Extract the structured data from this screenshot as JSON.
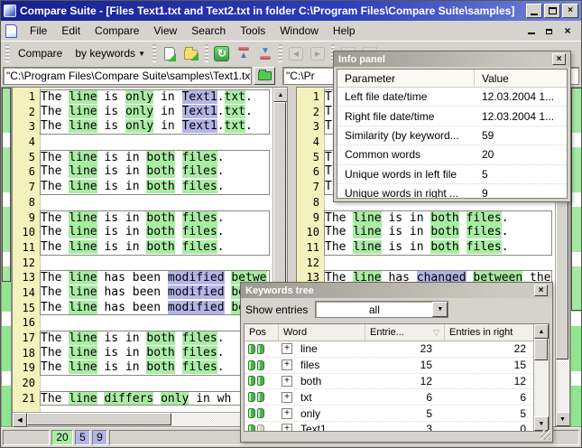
{
  "window": {
    "title": "Compare Suite - [Files Text1.txt and Text2.txt in folder C:\\Program Files\\Compare Suite\\samples]"
  },
  "menu": {
    "items": [
      "File",
      "Edit",
      "Compare",
      "View",
      "Search",
      "Tools",
      "Window",
      "Help"
    ]
  },
  "toolbar": {
    "compare_label": "Compare",
    "mode_label": "by keywords"
  },
  "paths": {
    "left": "\"C:\\Program Files\\Compare Suite\\samples\\Text1.txt\"",
    "right": "\"C:\\Pr"
  },
  "colors": {
    "highlight_common": "#a9eda4",
    "highlight_unique": "#b4b4e9",
    "map_green": "#8ee68e"
  },
  "left_pane": {
    "lines": [
      {
        "n": "1",
        "box": "start",
        "seg": [
          [
            "The ",
            ""
          ],
          [
            "line",
            "g"
          ],
          [
            " is ",
            ""
          ],
          [
            "only",
            "g"
          ],
          [
            " in ",
            ""
          ],
          [
            "Text1",
            "b"
          ],
          [
            ".",
            ""
          ],
          [
            "txt",
            "g"
          ],
          [
            ".",
            ""
          ]
        ]
      },
      {
        "n": "2",
        "box": "mid",
        "seg": [
          [
            "The ",
            ""
          ],
          [
            "line",
            "g"
          ],
          [
            " is ",
            ""
          ],
          [
            "only",
            "g"
          ],
          [
            " in ",
            ""
          ],
          [
            "Text1",
            "b"
          ],
          [
            ".",
            ""
          ],
          [
            "txt",
            "g"
          ],
          [
            ".",
            ""
          ]
        ]
      },
      {
        "n": "3",
        "box": "end",
        "seg": [
          [
            "The ",
            ""
          ],
          [
            "line",
            "g"
          ],
          [
            " is ",
            ""
          ],
          [
            "only",
            "g"
          ],
          [
            " in ",
            ""
          ],
          [
            "Text1",
            "b"
          ],
          [
            ".",
            ""
          ],
          [
            "txt",
            "g"
          ],
          [
            ".",
            ""
          ]
        ]
      },
      {
        "n": "4",
        "box": "none",
        "seg": []
      },
      {
        "n": "5",
        "box": "start",
        "seg": [
          [
            "The ",
            ""
          ],
          [
            "line",
            "g"
          ],
          [
            " is in ",
            ""
          ],
          [
            "both",
            "g"
          ],
          [
            " ",
            ""
          ],
          [
            "files",
            "g"
          ],
          [
            ".",
            ""
          ]
        ]
      },
      {
        "n": "6",
        "box": "mid",
        "seg": [
          [
            "The ",
            ""
          ],
          [
            "line",
            "g"
          ],
          [
            " is in ",
            ""
          ],
          [
            "both",
            "g"
          ],
          [
            " ",
            ""
          ],
          [
            "files",
            "g"
          ],
          [
            ".",
            ""
          ]
        ]
      },
      {
        "n": "7",
        "box": "end",
        "seg": [
          [
            "The ",
            ""
          ],
          [
            "line",
            "g"
          ],
          [
            " is in ",
            ""
          ],
          [
            "both",
            "g"
          ],
          [
            " ",
            ""
          ],
          [
            "files",
            "g"
          ],
          [
            ".",
            ""
          ]
        ]
      },
      {
        "n": "8",
        "box": "none",
        "seg": []
      },
      {
        "n": "9",
        "box": "start",
        "seg": [
          [
            "The ",
            ""
          ],
          [
            "line",
            "g"
          ],
          [
            " is in ",
            ""
          ],
          [
            "both",
            "g"
          ],
          [
            " ",
            ""
          ],
          [
            "files",
            "g"
          ],
          [
            ".",
            ""
          ]
        ]
      },
      {
        "n": "10",
        "box": "mid",
        "seg": [
          [
            "The ",
            ""
          ],
          [
            "line",
            "g"
          ],
          [
            " is in ",
            ""
          ],
          [
            "both",
            "g"
          ],
          [
            " ",
            ""
          ],
          [
            "files",
            "g"
          ],
          [
            ".",
            ""
          ]
        ]
      },
      {
        "n": "11",
        "box": "end",
        "seg": [
          [
            "The ",
            ""
          ],
          [
            "line",
            "g"
          ],
          [
            " is in ",
            ""
          ],
          [
            "both",
            "g"
          ],
          [
            " ",
            ""
          ],
          [
            "files",
            "g"
          ],
          [
            ".",
            ""
          ]
        ]
      },
      {
        "n": "12",
        "box": "none",
        "seg": []
      },
      {
        "n": "13",
        "box": "start",
        "seg": [
          [
            "The ",
            ""
          ],
          [
            "line",
            "g"
          ],
          [
            " has been ",
            ""
          ],
          [
            "modified",
            "b"
          ],
          [
            " ",
            ""
          ],
          [
            "betwe",
            "g"
          ]
        ]
      },
      {
        "n": "14",
        "box": "mid",
        "seg": [
          [
            "The ",
            ""
          ],
          [
            "line",
            "g"
          ],
          [
            " has been ",
            ""
          ],
          [
            "modified",
            "b"
          ],
          [
            " ",
            ""
          ],
          [
            "betwe",
            "g"
          ]
        ]
      },
      {
        "n": "15",
        "box": "end",
        "seg": [
          [
            "The ",
            ""
          ],
          [
            "line",
            "g"
          ],
          [
            " has been ",
            ""
          ],
          [
            "modified",
            "b"
          ],
          [
            " ",
            ""
          ],
          [
            "betwe",
            "g"
          ]
        ]
      },
      {
        "n": "16",
        "box": "none",
        "seg": []
      },
      {
        "n": "17",
        "box": "start",
        "seg": [
          [
            "The ",
            ""
          ],
          [
            "line",
            "g"
          ],
          [
            " is in ",
            ""
          ],
          [
            "both",
            "g"
          ],
          [
            " ",
            ""
          ],
          [
            "files",
            "g"
          ],
          [
            ".",
            ""
          ]
        ]
      },
      {
        "n": "18",
        "box": "mid",
        "seg": [
          [
            "The ",
            ""
          ],
          [
            "line",
            "g"
          ],
          [
            " is in ",
            ""
          ],
          [
            "both",
            "g"
          ],
          [
            " ",
            ""
          ],
          [
            "files",
            "g"
          ],
          [
            ".",
            ""
          ]
        ]
      },
      {
        "n": "19",
        "box": "end",
        "seg": [
          [
            "The ",
            ""
          ],
          [
            "line",
            "g"
          ],
          [
            " is in ",
            ""
          ],
          [
            "both",
            "g"
          ],
          [
            " ",
            ""
          ],
          [
            "files",
            "g"
          ],
          [
            ".",
            ""
          ]
        ]
      },
      {
        "n": "20",
        "box": "none",
        "seg": []
      },
      {
        "n": "21",
        "box": "single",
        "seg": [
          [
            "The ",
            ""
          ],
          [
            "line",
            "g"
          ],
          [
            " ",
            ""
          ],
          [
            "differs",
            "g"
          ],
          [
            " ",
            ""
          ],
          [
            "only",
            "g"
          ],
          [
            " in wh",
            ""
          ]
        ]
      }
    ]
  },
  "right_pane": {
    "lines": [
      {
        "n": "1",
        "box": "start",
        "seg": [
          [
            "T",
            ""
          ]
        ]
      },
      {
        "n": "2",
        "box": "mid",
        "seg": [
          [
            "T",
            ""
          ]
        ]
      },
      {
        "n": "3",
        "box": "end",
        "seg": [
          [
            "T",
            ""
          ]
        ]
      },
      {
        "n": "4",
        "box": "none",
        "seg": []
      },
      {
        "n": "5",
        "box": "start",
        "seg": [
          [
            "T",
            ""
          ]
        ]
      },
      {
        "n": "6",
        "box": "mid",
        "seg": [
          [
            "T",
            ""
          ]
        ]
      },
      {
        "n": "7",
        "box": "end",
        "seg": [
          [
            "T",
            ""
          ]
        ]
      },
      {
        "n": "8",
        "box": "none",
        "seg": []
      },
      {
        "n": "9",
        "box": "start",
        "seg": [
          [
            "The ",
            ""
          ],
          [
            "line",
            "g"
          ],
          [
            " is in ",
            ""
          ],
          [
            "both",
            "g"
          ],
          [
            " ",
            ""
          ],
          [
            "files",
            "g"
          ],
          [
            ".",
            ""
          ]
        ]
      },
      {
        "n": "10",
        "box": "mid",
        "seg": [
          [
            "The ",
            ""
          ],
          [
            "line",
            "g"
          ],
          [
            " is in ",
            ""
          ],
          [
            "both",
            "g"
          ],
          [
            " ",
            ""
          ],
          [
            "files",
            "g"
          ],
          [
            ".",
            ""
          ]
        ]
      },
      {
        "n": "11",
        "box": "end",
        "seg": [
          [
            "The ",
            ""
          ],
          [
            "line",
            "g"
          ],
          [
            " is in ",
            ""
          ],
          [
            "both",
            "g"
          ],
          [
            " ",
            ""
          ],
          [
            "files",
            "g"
          ],
          [
            ".",
            ""
          ]
        ]
      },
      {
        "n": "12",
        "box": "none",
        "seg": []
      },
      {
        "n": "13",
        "box": "start",
        "seg": [
          [
            "The ",
            ""
          ],
          [
            "line",
            "g"
          ],
          [
            " has ",
            ""
          ],
          [
            "changed",
            "b"
          ],
          [
            " ",
            ""
          ],
          [
            "between",
            "g"
          ],
          [
            " the",
            ""
          ]
        ]
      }
    ]
  },
  "info_panel": {
    "title": "Info panel",
    "columns": [
      "Parameter",
      "Value"
    ],
    "rows": [
      [
        "Left file date/time",
        "12.03.2004 1..."
      ],
      [
        "Right file date/time",
        "12.03.2004 1..."
      ],
      [
        "Similarity (by keyword...",
        "59"
      ],
      [
        "Common words",
        "20"
      ],
      [
        "Unique words in left file",
        "5"
      ],
      [
        "Unique words in right ...",
        "9"
      ]
    ]
  },
  "keywords_panel": {
    "title": "Keywords tree",
    "filter_label": "Show entries",
    "filter_value": "all",
    "columns": [
      "Pos",
      "Word",
      "Entrie...",
      "Entries in right"
    ],
    "rows": [
      {
        "word": "line",
        "entries_left": "23",
        "entries_right": "22",
        "in_left": true,
        "in_right": true
      },
      {
        "word": "files",
        "entries_left": "15",
        "entries_right": "15",
        "in_left": true,
        "in_right": true
      },
      {
        "word": "both",
        "entries_left": "12",
        "entries_right": "12",
        "in_left": true,
        "in_right": true
      },
      {
        "word": "txt",
        "entries_left": "6",
        "entries_right": "6",
        "in_left": true,
        "in_right": true
      },
      {
        "word": "only",
        "entries_left": "5",
        "entries_right": "5",
        "in_left": true,
        "in_right": true
      },
      {
        "word": "Text1",
        "entries_left": "3",
        "entries_right": "0",
        "in_left": true,
        "in_right": false
      }
    ]
  },
  "status_bar": {
    "common_words": "20",
    "unique_left": "5",
    "unique_right": "9"
  }
}
